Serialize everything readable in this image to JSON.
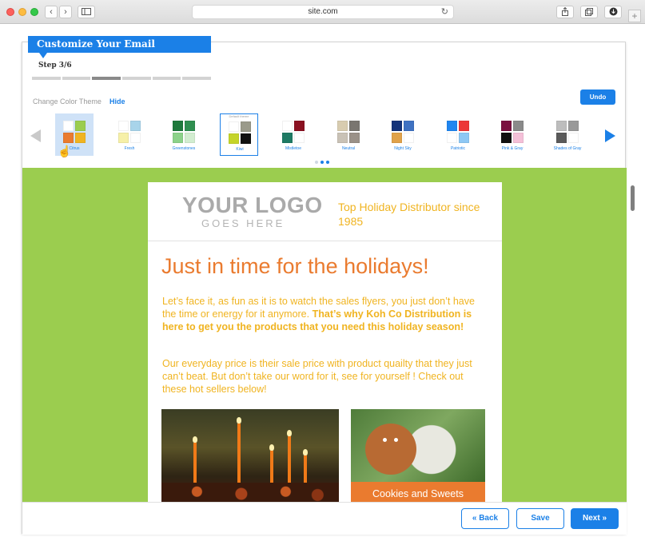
{
  "browser": {
    "url": "site.com",
    "nav_back_icon": "chevron-left-icon",
    "nav_forward_icon": "chevron-right-icon",
    "sidebar_icon": "sidebar-icon",
    "reload_icon": "reload-icon",
    "share_icon": "share-icon",
    "tabs_icon": "tabs-icon",
    "download_icon": "download-icon",
    "new_tab_icon": "plus-icon"
  },
  "wizard": {
    "title": "Customize Your Email",
    "step_label": "Step 3/6",
    "current_step": 3,
    "total_steps": 6
  },
  "theme_picker": {
    "label": "Change Color Theme",
    "hide_label": "Hide",
    "undo_label": "Undo",
    "default_tag": "Default theme",
    "themes": [
      {
        "name": "Citrus",
        "colors": [
          "#ffffff",
          "#9bcd4f",
          "#ea7b2f",
          "#f0b421"
        ],
        "selected": true
      },
      {
        "name": "Fresh",
        "colors": [
          "#ffffff",
          "#a8d4ea",
          "#f6f0a8",
          "#ffffff"
        ]
      },
      {
        "name": "Greenstones",
        "colors": [
          "#1e7a3c",
          "#2f8f50",
          "#8cd28a",
          "#d2edd0"
        ]
      },
      {
        "name": "Kiwi",
        "colors": [
          "#ffffff",
          "#9a9a8a",
          "#c5d42a",
          "#111111"
        ],
        "default": true
      },
      {
        "name": "Mistletoe",
        "colors": [
          "#ffffff",
          "#8a1020",
          "#1e7a64",
          "#ffffff"
        ]
      },
      {
        "name": "Neutral",
        "colors": [
          "#d8ccb0",
          "#7a7670",
          "#c9c2b6",
          "#9a9188"
        ]
      },
      {
        "name": "Night Sky",
        "colors": [
          "#14337a",
          "#3f72c2",
          "#e0a24a",
          "#ffffff"
        ]
      },
      {
        "name": "Patriotic",
        "colors": [
          "#1f86f0",
          "#ec3838",
          "#ffffff",
          "#8ec8f4"
        ]
      },
      {
        "name": "Pink & Gray",
        "colors": [
          "#7a1040",
          "#8a8a8a",
          "#111111",
          "#f4c0d8"
        ]
      },
      {
        "name": "Shades of Gray",
        "colors": [
          "#bdbdbd",
          "#999999",
          "#5a5a5a",
          "#ffffff"
        ]
      }
    ],
    "page_dots": 3,
    "active_dot": 2
  },
  "email": {
    "logo_main": "YOUR LOGO",
    "logo_sub": "GOES HERE",
    "tagline": "Top Holiday Distributor since 1985",
    "headline": "Just in time for the holidays!",
    "para1_plain": "Let’s face it, as fun as it is to watch the sales flyers, you just don’t have the time or energy for it anymore. ",
    "para1_bold": "That’s why Koh Co Distribution is here to get you the products that you need this holiday season!",
    "para2": "Our everyday price is their sale price with product quailty that they just can’t beat. But don’t take our word for it, see for yourself ! Check out these hot sellers below!",
    "caption2": "Cookies and Sweets"
  },
  "footer": {
    "back_label": "« Back",
    "save_label": "Save",
    "next_label": "Next »"
  },
  "colors": {
    "accent": "#1b80e7",
    "preview_bg": "#9bcd4f",
    "orange": "#ea7b2f",
    "gold": "#f0b421"
  }
}
